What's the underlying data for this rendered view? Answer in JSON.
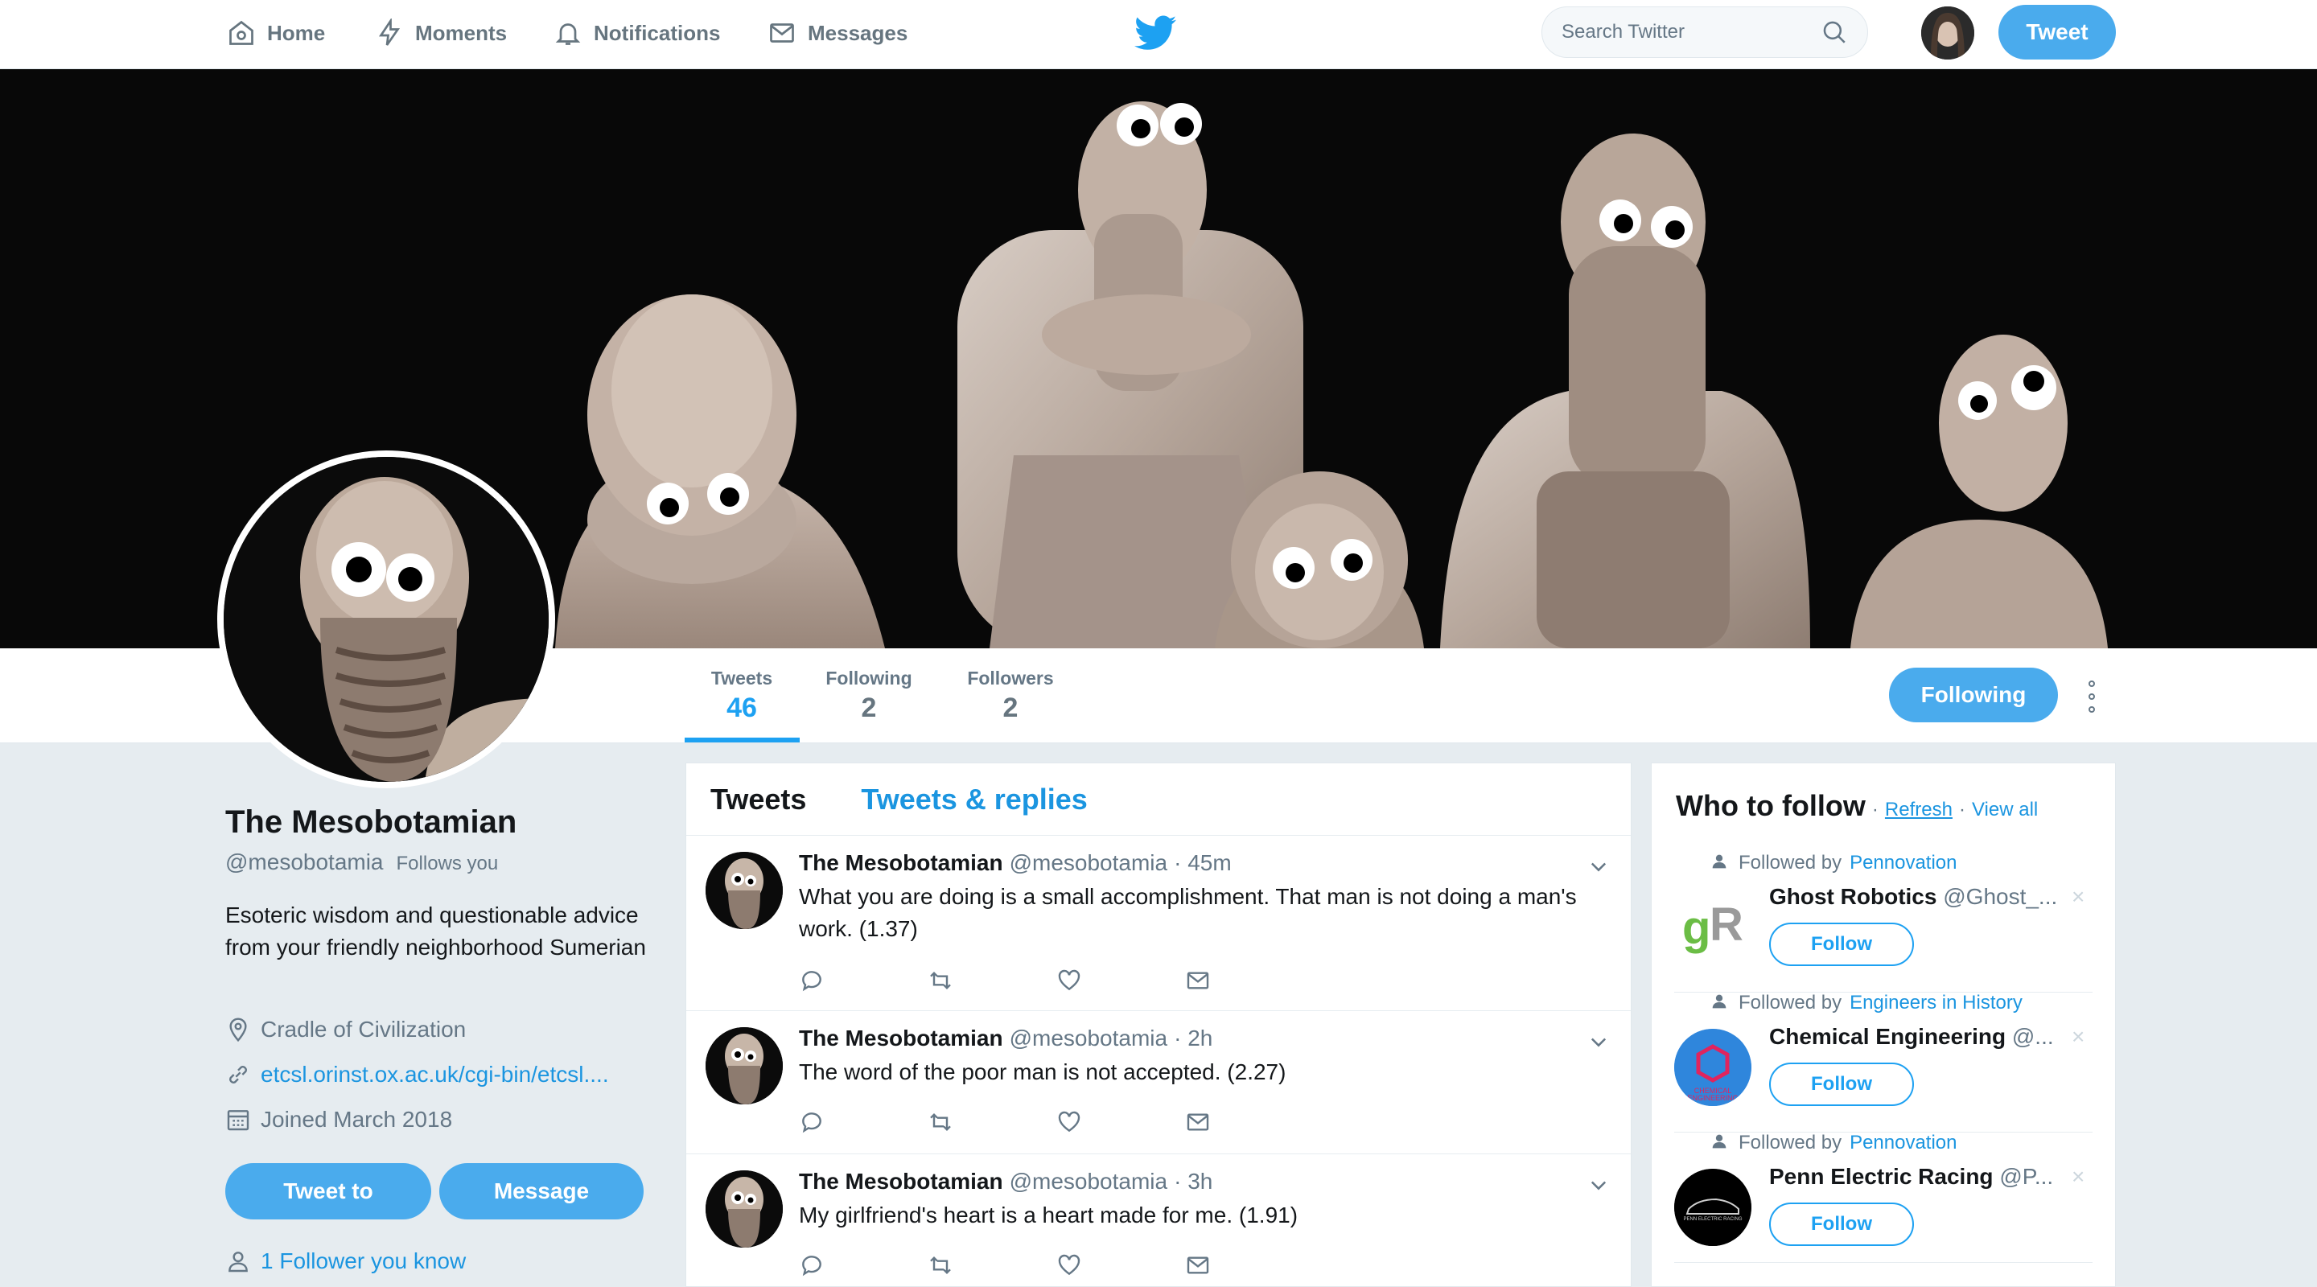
{
  "topnav": {
    "home": "Home",
    "moments": "Moments",
    "notifications": "Notifications",
    "messages": "Messages",
    "search_placeholder": "Search Twitter",
    "tweet_button": "Tweet"
  },
  "profile": {
    "name": "The Mesobotamian",
    "handle": "@mesobotamia",
    "follows_you": "Follows you",
    "bio": "Esoteric wisdom and questionable advice from your friendly neighborhood Sumerian",
    "location": "Cradle of Civilization",
    "url": "etcsl.orinst.ox.ac.uk/cgi-bin/etcsl....",
    "joined": "Joined March 2018",
    "tweet_to_button": "Tweet to",
    "message_button": "Message",
    "followers_you_know": "1 Follower you know"
  },
  "stats": [
    {
      "label": "Tweets",
      "value": "46"
    },
    {
      "label": "Following",
      "value": "2"
    },
    {
      "label": "Followers",
      "value": "2"
    }
  ],
  "following_button": "Following",
  "timeline": {
    "tabs": [
      "Tweets",
      "Tweets & replies"
    ],
    "tweets": [
      {
        "name": "The Mesobotamian",
        "handle": "@mesobotamia",
        "time": "· 45m",
        "text": "What you are doing is a small accomplishment. That man is not doing a man's work. (1.37)"
      },
      {
        "name": "The Mesobotamian",
        "handle": "@mesobotamia",
        "time": "· 2h",
        "text": "The word of the poor man is not accepted. (2.27)"
      },
      {
        "name": "The Mesobotamian",
        "handle": "@mesobotamia",
        "time": "· 3h",
        "text": "My girlfriend's heart is a heart made for me. (1.91)"
      }
    ]
  },
  "who_to_follow": {
    "title": "Who to follow",
    "separator": "·",
    "refresh": "Refresh",
    "view_all": "View all",
    "followed_by_prefix": "Followed by",
    "follow_button": "Follow",
    "dismiss": "×",
    "items": [
      {
        "followed_by": "Pennovation",
        "name": "Ghost Robotics",
        "handle": "@Ghost_...",
        "avatar_text": "gR"
      },
      {
        "followed_by": "Engineers in History",
        "name": "Chemical Engineering",
        "handle": "@...",
        "avatar_text": "CHEMICAL ENGINEERING"
      },
      {
        "followed_by": "Pennovation",
        "name": "Penn Electric Racing",
        "handle": "@P...",
        "avatar_text": "PENN ELECTRIC RACING"
      }
    ]
  },
  "colors": {
    "accent": "#1da1f2",
    "button_fill": "#4aabed",
    "background": "#e6ecf0"
  },
  "icons": [
    "home-icon",
    "moments-icon",
    "notifications-icon",
    "messages-icon",
    "twitter-bird-icon",
    "search-icon",
    "location-icon",
    "link-icon",
    "calendar-icon",
    "person-icon",
    "reply-icon",
    "retweet-icon",
    "like-icon",
    "dm-icon",
    "chevron-down-icon",
    "more-icon",
    "close-icon"
  ]
}
